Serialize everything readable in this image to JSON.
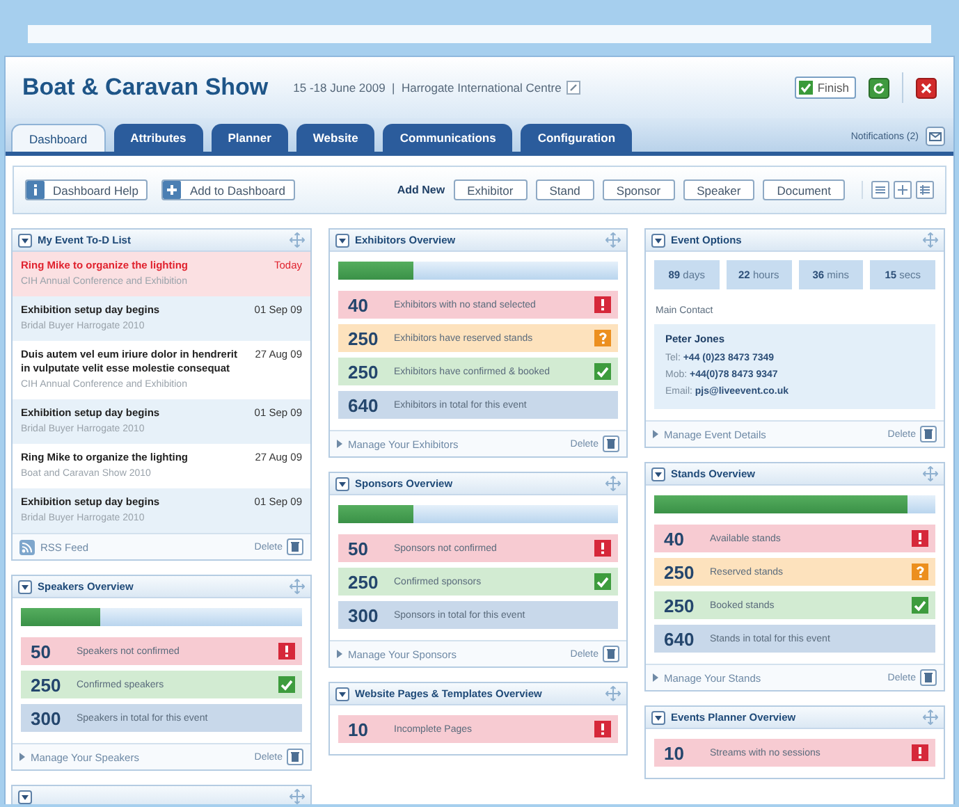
{
  "window": {
    "title": "Boat & Caravan Show",
    "subtitle": "15 -18 June 2009  |  Harrogate International Centre"
  },
  "header_buttons": {
    "finish": "Finish"
  },
  "tabs": [
    {
      "label": "Dashboard",
      "selected": true
    },
    {
      "label": "Attributes",
      "selected": false
    },
    {
      "label": "Planner",
      "selected": false
    },
    {
      "label": "Website",
      "selected": false
    },
    {
      "label": "Communications",
      "selected": false
    },
    {
      "label": "Configuration",
      "selected": false
    }
  ],
  "notifications": {
    "label": "Notifications (2)"
  },
  "toolbar": {
    "buttons": [
      {
        "label": "Dashboard Help",
        "kind": "help"
      },
      {
        "label": "Add to Dashboard",
        "kind": "add"
      }
    ],
    "add_new_label": "Add New",
    "add_new": [
      "Exhibitor",
      "Stand",
      "Sponsor",
      "Speaker",
      "Document"
    ]
  },
  "columns": [
    [
      {
        "kind": "todo",
        "title": "My Event To-D List",
        "items": [
          {
            "title": "Ring Mike to organize the lighting",
            "event": "CIH Annual Conference and Exhibition",
            "date": "Today",
            "urgent": true
          },
          {
            "title": "Exhibition setup day begins",
            "event": "Bridal Buyer Harrogate 2010",
            "date": "01 Sep 09",
            "urgent": false
          },
          {
            "title": "Duis autem vel eum iriure dolor in hendrerit in vulputate velit esse molestie consequat",
            "event": "CIH Annual Conference and Exhibition",
            "date": "27 Aug 09",
            "urgent": false
          },
          {
            "title": "Exhibition setup day begins",
            "event": "Bridal Buyer Harrogate 2010",
            "date": "01 Sep 09",
            "urgent": false
          },
          {
            "title": "Ring Mike to organize the lighting",
            "event": "Boat and Caravan Show 2010",
            "date": "27 Aug 09",
            "urgent": false
          },
          {
            "title": "Exhibition setup day begins",
            "event": "Bridal Buyer Harrogate 2010",
            "date": "01 Sep 09",
            "urgent": false
          }
        ],
        "rss": "RSS Feed",
        "delete": "Delete"
      },
      {
        "kind": "stats",
        "title": "Speakers Overview",
        "level": 0.28,
        "rows": [
          {
            "kind": "alert",
            "count": "50",
            "label": "Speakers not confirmed"
          },
          {
            "kind": "ok",
            "count": "250",
            "label": "Confirmed speakers"
          },
          {
            "kind": "total",
            "count": "300",
            "label": "Speakers in total for this event"
          }
        ],
        "link": "Manage Your Speakers",
        "delete": "Delete"
      },
      {
        "kind": "stub"
      }
    ],
    [
      {
        "kind": "stats",
        "title": "Exhibitors Overview",
        "level": 0.27,
        "rows": [
          {
            "kind": "alert",
            "count": "40",
            "label": "Exhibitors with no stand selected"
          },
          {
            "kind": "warning",
            "count": "250",
            "label": "Exhibitors have reserved stands"
          },
          {
            "kind": "ok",
            "count": "250",
            "label": "Exhibitors have confirmed & booked"
          },
          {
            "kind": "total",
            "count": "640",
            "label": "Exhibitors in total for this event"
          }
        ],
        "link": "Manage Your Exhibitors",
        "delete": "Delete"
      },
      {
        "kind": "stats",
        "title": "Sponsors Overview",
        "level": 0.27,
        "rows": [
          {
            "kind": "alert",
            "count": "50",
            "label": "Sponsors not confirmed"
          },
          {
            "kind": "ok",
            "count": "250",
            "label": "Confirmed sponsors"
          },
          {
            "kind": "total",
            "count": "300",
            "label": "Sponsors in total for this event"
          }
        ],
        "link": "Manage Your Sponsors",
        "delete": "Delete"
      },
      {
        "kind": "stats",
        "title": "Website Pages & Templates Overview",
        "rows": [
          {
            "kind": "alert",
            "count": "10",
            "label": "Incomplete Pages"
          }
        ]
      }
    ],
    [
      {
        "kind": "event_options",
        "title": "Event Options",
        "countdown": [
          "**89** days",
          "**22** hours",
          "**36** mins",
          "**15** secs"
        ],
        "contact_label": "Main Contact",
        "contact_name": "Peter Jones",
        "contact_lines": [
          "Tel: **+44 (0)23 8473 7349**",
          "Mob: **+44(0)78 8473 9347**",
          "Email: **pjs@liveevent.co.uk**"
        ],
        "link": "Manage Event Details",
        "delete": "Delete"
      },
      {
        "kind": "stats",
        "title": "Stands Overview",
        "level": 0.9,
        "rows": [
          {
            "kind": "alert",
            "count": "40",
            "label": "Available stands"
          },
          {
            "kind": "warning",
            "count": "250",
            "label": "Reserved stands"
          },
          {
            "kind": "ok",
            "count": "250",
            "label": "Booked stands"
          },
          {
            "kind": "total",
            "count": "640",
            "label": "Stands in total for this event"
          }
        ],
        "link": "Manage Your Stands",
        "delete": "Delete"
      },
      {
        "kind": "stats",
        "title": "Events Planner Overview",
        "rows": [
          {
            "kind": "alert",
            "count": "10",
            "label": "Streams with no sessions"
          }
        ]
      }
    ]
  ]
}
